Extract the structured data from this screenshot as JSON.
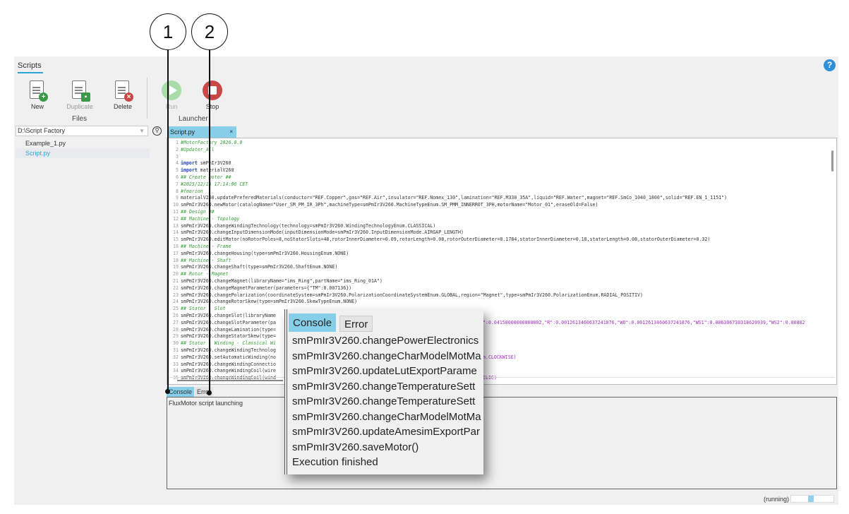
{
  "panel_tab": "Scripts",
  "help_icon": "?",
  "toolbar": {
    "files": [
      {
        "label": "New",
        "badge": "+",
        "color": "#3a9a4a"
      },
      {
        "label": "Duplicate",
        "badge": "▪",
        "color": "#3a9a4a"
      },
      {
        "label": "Delete",
        "badge": "×",
        "color": "#c84848"
      }
    ],
    "files_group": "Files",
    "run_label": "Run",
    "stop_label": "Stop",
    "launcher_group": "Launcher"
  },
  "explorer": {
    "folder": "D:\\Script Factory",
    "files": [
      "Example_1.py",
      "Script.py"
    ],
    "selected": 1
  },
  "editor": {
    "tab": "Script.py",
    "close": "×",
    "lines": [
      "#MotorFactory 2026.0.0",
      "#Updater_All",
      "",
      "import smPmIr3V260",
      "import materialV260",
      "## Create motor ##",
      "#2025/12/15 17:14:06 CET",
      "#fmarion",
      "materialV260.updatePreferedMaterials(conductor=\"REF.Copper\",gas=\"REF.Air\",insulator=\"REF.Nomex_130\",lamination=\"REF.M330_35A\",liquid=\"REF.Water\",magnet=\"REF.SmCo_1040_1800\",solid=\"REF.EN_1_1151\")",
      "smPmIr3V260.newMotor(catalogName=\"User_SM_PM_IR_3Ph\",machineType=smPmIr3V260.MachineTypeEnum.SM_PMM_INNERROT_3PH,motorName=\"Motor_01\",eraseOld=False)",
      "## Design ##",
      "## Machine - Topology",
      "smPmIr3V260.changeWindingTechnology(technology=smPmIr3V260.WindingTechnologyEnum.CLASSICAL)",
      "smPmIr3V260.changeInputDimensionMode(inputDimensionMode=smPmIr3V260.InputDimensionMode.AIRGAP_LENGTH)",
      "smPmIr3V260.editMotor(noRotorPoles=8,noStatorSlots=48,rotorInnerDiameter=0.09,rotorLength=0.08,rotorOuterDiameter=0.1784,statorInnerDiameter=0.18,statorLength=0.08,statorOuterDiameter=0.32)",
      "## Machine - Frame",
      "smPmIr3V260.changeHousing(type=smPmIr3V260.HousingEnum.NONE)",
      "## Machine - Shaft",
      "smPmIr3V260.changeShaft(type=smPmIr3V260.ShaftEnum.NONE)",
      "## Rotor - Magnet",
      "smPmIr3V260.changeMagnet(libraryName=\"ims_Ring\",partName=\"ims_Ring_01A\")",
      "smPmIr3V260.changeMagnetParameter(parameters={\"TM\":0.007136})",
      "smPmIr3V260.changePolarization(coordinateSystem=smPmIr3V260.PolarizationCoordinateSystemEnum.GLOBAL,region=\"Magnet\",type=smPmIr3V260.PolarizationEnum.RADIAL_POSITIV)",
      "smPmIr3V260.changeRotorSkew(type=smPmIr3V260.SkewTypeEnum.NONE)",
      "## Stator - Slot",
      "smPmIr3V260.changeSlot(libraryName",
      "smPmIr3V260.changeSlotParameter(pa",
      "smPmIr3V260.changeLamination(type=",
      "smPmIr3V260.changeStatorSkew(type=",
      "## Stator - Winding - Classical Wi",
      "smPmIr3V260.changeWindingTechnolog",
      "smPmIr3V260.setAutomaticWinding(no",
      "smPmIr3V260.changeWindingConnectio",
      "smPmIr3V260.changeWindingCoil(wire",
      "smPmIr3V260.changeWindingCoil(wind"
    ],
    "tails": [
      {
        "line": 27,
        "text": "\":0.04158000000000002,\"R\":0.0012613460637241876,\"WO\":0.0012613460637241876,\"WS1\":0.006306730318620939,\"WS2\":0.00882"
      },
      {
        "line": 32,
        "text": "m.CLOCKWISE)"
      },
      {
        "line": 35,
        "text": "CLIC)"
      }
    ]
  },
  "console": {
    "tabs": [
      "Console",
      "Error"
    ],
    "text": "FluxMotor script launching"
  },
  "status": {
    "text": "(running)"
  },
  "zoom_popup": {
    "tabs": [
      "Console",
      "Error"
    ],
    "lines": [
      "smPmIr3V260.changePowerElectronics",
      "smPmIr3V260.changeCharModelMotMa",
      "smPmIr3V260.updateLutExportParame",
      "smPmIr3V260.changeTemperatureSett",
      "smPmIr3V260.changeTemperatureSett",
      "smPmIr3V260.changeCharModelMotMa",
      "smPmIr3V260.updateAmesimExportPar",
      "smPmIr3V260.saveMotor()",
      "Execution finished"
    ]
  },
  "callouts": [
    "1",
    "2"
  ],
  "colors": {
    "accent": "#87cfe8",
    "run": "#8fd08f",
    "stop": "#c84848"
  }
}
